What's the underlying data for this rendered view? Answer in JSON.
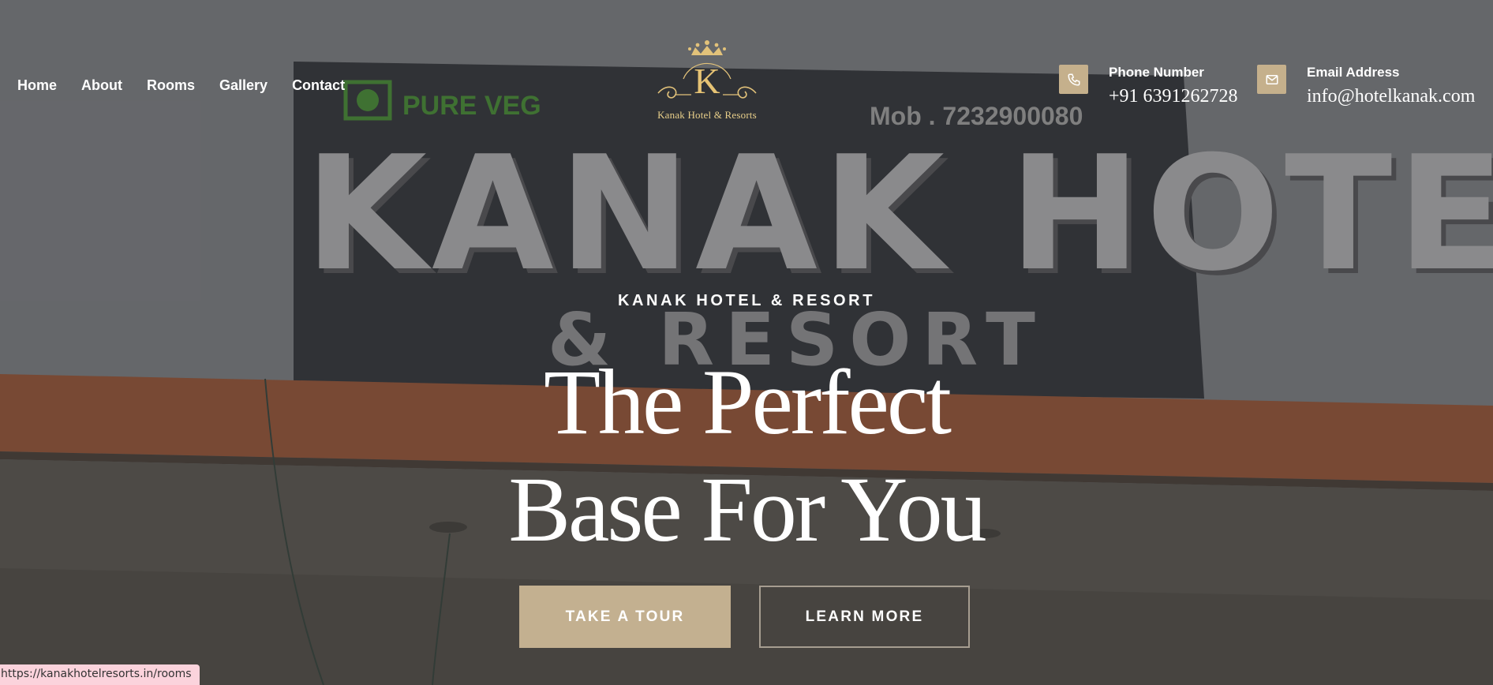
{
  "nav": {
    "items": [
      "Home",
      "About",
      "Rooms",
      "Gallery",
      "Contact"
    ]
  },
  "logo": {
    "letter": "K",
    "text": "Kanak Hotel & Resorts"
  },
  "contacts": {
    "phone": {
      "label": "Phone Number",
      "value": "+91 6391262728",
      "icon": "phone-icon"
    },
    "email": {
      "label": "Email Address",
      "value": "info@hotelkanak.com",
      "icon": "envelope-icon"
    }
  },
  "hero": {
    "eyebrow": "KANAK HOTEL & RESORT",
    "headline_line1": "The Perfect",
    "headline_line2": "Base For You",
    "photo_sign": {
      "pure_veg": "PURE VEG",
      "mobile": "Mob . 7232900080",
      "title": "KANAK HOTEL",
      "subtitle": "& RESORT"
    }
  },
  "buttons": {
    "tour": "TAKE A TOUR",
    "learn": "LEARN MORE"
  },
  "statusbar": {
    "url": "https://kanakhotelresorts.in/rooms"
  },
  "colors": {
    "accent": "#c3b090",
    "gold": "#e8cf8a",
    "text": "#ffffff"
  }
}
